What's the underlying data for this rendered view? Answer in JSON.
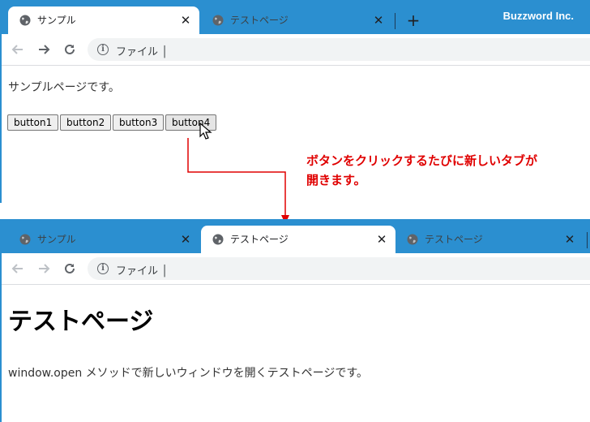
{
  "brand": "Buzzword Inc.",
  "top_window": {
    "tabs": [
      {
        "title": "サンプル",
        "close": "✕",
        "active": true
      },
      {
        "title": "テストページ",
        "close": "✕",
        "active": false
      }
    ],
    "new_tab": "+",
    "address_text": "ファイル │",
    "page_text": "サンプルページです。",
    "buttons": [
      "button1",
      "button2",
      "button3",
      "button4"
    ]
  },
  "bottom_window": {
    "tabs": [
      {
        "title": "サンプル",
        "close": "✕",
        "active": false
      },
      {
        "title": "テストページ",
        "close": "✕",
        "active": true
      },
      {
        "title": "テストページ",
        "close": "✕",
        "active": false
      }
    ],
    "address_text": "ファイル │",
    "heading": "テストページ",
    "page_text": "window.open メソッドで新しいウィンドウを開くテストページです。"
  },
  "annotation": {
    "line1": "ボタンをクリックするたびに新しいタブが",
    "line2": "開きます。"
  },
  "colors": {
    "tabbar": "#2b8fd0",
    "annotation": "#e00000"
  },
  "icons": [
    "globe-icon",
    "close-icon",
    "back-arrow-icon",
    "forward-arrow-icon",
    "reload-icon",
    "info-icon",
    "mouse-cursor-icon"
  ]
}
